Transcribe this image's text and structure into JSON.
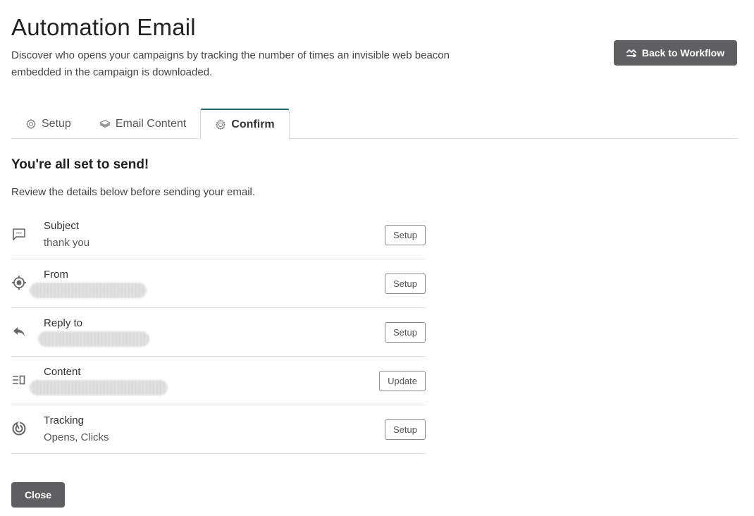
{
  "header": {
    "title": "Automation Email",
    "description": "Discover who opens your campaigns by tracking the number of times an invisible web beacon embedded in the campaign is downloaded.",
    "back_button": "Back to Workflow"
  },
  "tabs": [
    {
      "label": "Setup",
      "icon": "gear-icon",
      "active": false
    },
    {
      "label": "Email Content",
      "icon": "layers-icon",
      "active": false
    },
    {
      "label": "Confirm",
      "icon": "gear-icon",
      "active": true
    }
  ],
  "confirm": {
    "title": "You're all set to send!",
    "subtitle": "Review the details below before sending your email.",
    "rows": [
      {
        "label": "Subject",
        "value": "thank you",
        "icon": "message-icon",
        "action": "Setup",
        "redacted": false
      },
      {
        "label": "From",
        "value": "",
        "icon": "target-icon",
        "action": "Setup",
        "redacted": true
      },
      {
        "label": "Reply to",
        "value": "",
        "icon": "reply-icon",
        "action": "Setup",
        "redacted": true
      },
      {
        "label": "Content",
        "value": "",
        "icon": "content-icon",
        "action": "Update",
        "redacted": true
      },
      {
        "label": "Tracking",
        "value": "Opens, Clicks",
        "icon": "tracking-icon",
        "action": "Setup",
        "redacted": false
      }
    ]
  },
  "footer": {
    "close_button": "Close"
  }
}
